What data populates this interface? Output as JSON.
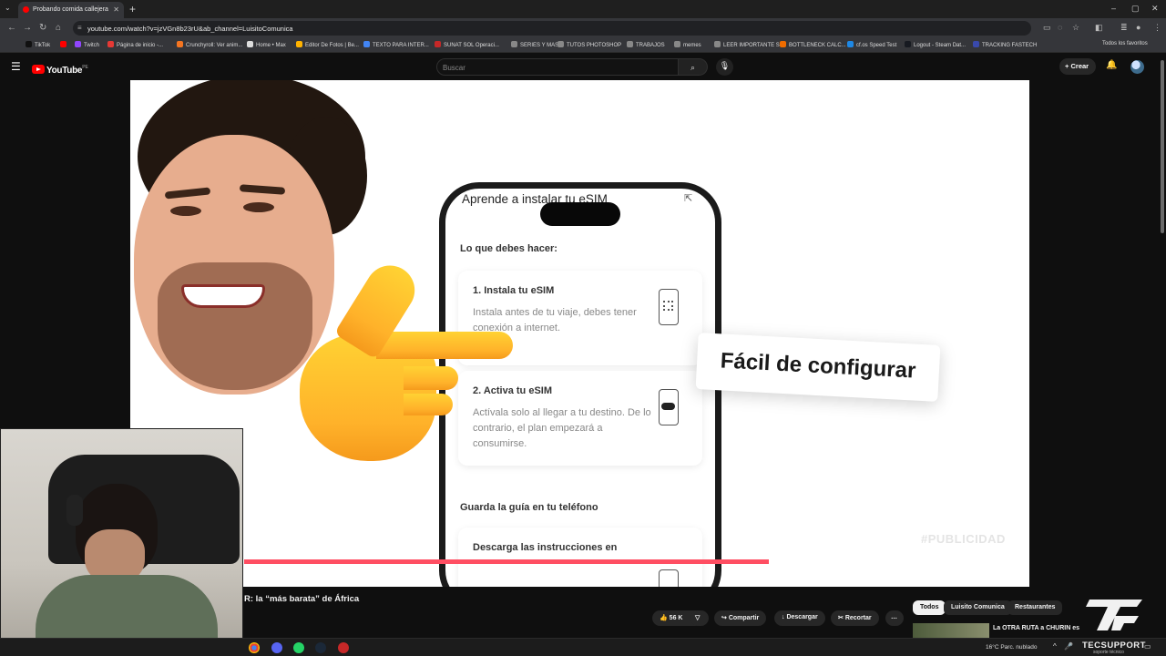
{
  "browser": {
    "tab_title": "Probando comida callejera",
    "url": "youtube.com/watch?v=jzVGn8b23rU&ab_channel=LuisitoComunica",
    "bookmarks": [
      {
        "label": "TikTok",
        "color": "#111111"
      },
      {
        "label": "",
        "color": "#ff0000"
      },
      {
        "label": "Twitch",
        "color": "#9146ff"
      },
      {
        "label": "Página de inicio -...",
        "color": "#e53935"
      },
      {
        "label": "Crunchyroll: Ver anim...",
        "color": "#f47521"
      },
      {
        "label": "Home • Max",
        "color": "#dddddd"
      },
      {
        "label": "Editor De Fotos | Be...",
        "color": "#ffb300"
      },
      {
        "label": "TEXTO PARA INTER...",
        "color": "#4285f4"
      },
      {
        "label": "SUNAT SOL Operaci...",
        "color": "#c62828"
      },
      {
        "label": "SERIES Y MAS",
        "color": "#888888"
      },
      {
        "label": "TUTOS PHOTOSHOP",
        "color": "#888888"
      },
      {
        "label": "TRABAJOS",
        "color": "#888888"
      },
      {
        "label": "memes",
        "color": "#888888"
      },
      {
        "label": "LEER IMPORTANTE S",
        "color": "#888888"
      },
      {
        "label": "BOTTLENECK CALC...",
        "color": "#ef6c00"
      },
      {
        "label": "cf.os Speed Test",
        "color": "#1e88e5"
      },
      {
        "label": "Logout - Steam Dat...",
        "color": "#171a21"
      },
      {
        "label": "TRACKING FASTECH",
        "color": "#3949ab"
      }
    ],
    "all_bookmarks": "Todos los favoritos"
  },
  "youtube": {
    "logo_text": "YouTube",
    "country": "PE",
    "search_placeholder": "Buscar",
    "create_label": "Crear"
  },
  "video": {
    "phone_title": "Aprende a instalar tu eSIM",
    "section_what_to_do": "Lo que debes hacer:",
    "step1_title": "1. Instala tu eSIM",
    "step1_body": "Instala antes de tu viaje, debes tener conexión a internet.",
    "step2_title": "2. Activa tu eSIM",
    "step2_body": "Actívala solo al llegar a tu destino. De lo contrario, el plan empezará a consumirse.",
    "section_save_guide": "Guarda la guía en tu teléfono",
    "step3_title": "Descarga las instrucciones en",
    "callout": "Fácil de configurar",
    "watermark": "#PUBLICIDAD",
    "progress": 0.67
  },
  "below": {
    "title": "R: la “más barata” de África",
    "likes": "56 K",
    "share": "Compartir",
    "download": "Descargar",
    "clip": "Recortar"
  },
  "chips": [
    "Todos",
    "Luisito Comunica",
    "Restaurantes"
  ],
  "recommendation": {
    "title": "La OTRA RUTA a CHURIN es"
  },
  "taskbar": {
    "weather": "16°C  Parc. nublado"
  },
  "brand": {
    "name": "TECSUPPORT",
    "sub": "soporte técnico"
  },
  "colors": {
    "accent_red": "#ff0000",
    "progress": "#ff4e62",
    "emoji_yellow": "#ffc832"
  }
}
